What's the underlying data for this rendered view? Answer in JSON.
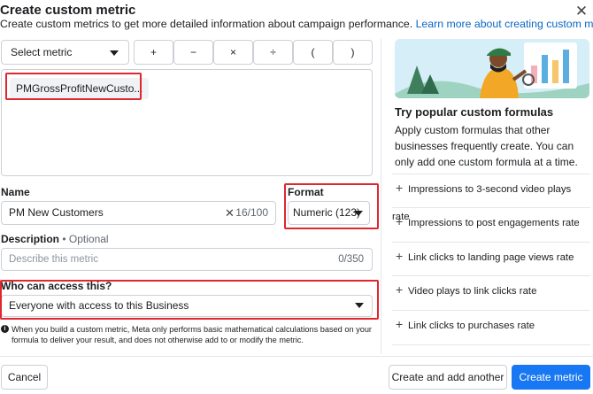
{
  "header": {
    "title": "Create custom metric",
    "subtitle": "Create custom metrics to get more detailed information about campaign performance.",
    "learn_more": "Learn more about creating custom metrics",
    "close_glyph": "✕"
  },
  "formula_builder": {
    "select_metric_label": "Select metric",
    "operators": [
      "+",
      "−",
      "×",
      "÷",
      "(",
      ")"
    ],
    "formula_chip": "PMGrossProfitNewCusto..."
  },
  "name": {
    "label": "Name",
    "value": "PM New Customers",
    "counter": "16/100",
    "clear_glyph": "✕"
  },
  "format": {
    "label": "Format",
    "value": "Numeric (123)"
  },
  "description": {
    "label": "Description",
    "optional": "• Optional",
    "placeholder": "Describe this metric",
    "counter": "0/350"
  },
  "access": {
    "label": "Who can access this?",
    "value": "Everyone with access to this Business"
  },
  "info_note": "When you build a custom metric, Meta only performs basic mathematical calculations based on your formula to deliver your result, and does not otherwise add to or modify the metric.",
  "popular": {
    "title": "Try popular custom formulas",
    "description": "Apply custom formulas that other businesses frequently create. You can only add one custom formula at a time.",
    "formulas": [
      "Impressions to 3-second video plays rate",
      "Impressions to post engagements rate",
      "Link clicks to landing page views rate",
      "Video plays to link clicks rate",
      "Link clicks to purchases rate"
    ]
  },
  "footer": {
    "cancel": "Cancel",
    "create_and_add": "Create and add another",
    "create": "Create metric"
  },
  "colors": {
    "primary": "#1877f2",
    "link": "#0a66c2",
    "highlight": "#e0262e"
  }
}
